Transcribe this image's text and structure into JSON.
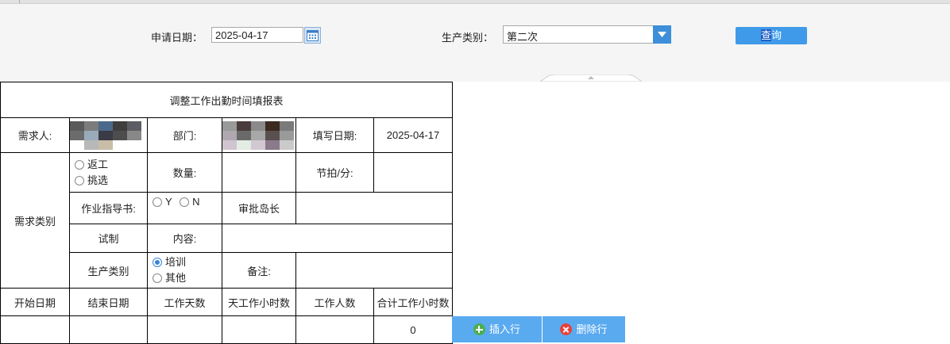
{
  "filters": {
    "apply_date_label": "申请日期：",
    "apply_date_value": "2025-04-17",
    "production_type_label": "生产类别：",
    "production_type_value": "第二次",
    "query_label_highlight": "查",
    "query_label_rest": "询"
  },
  "form": {
    "title": "调整工作出勤时间填报表",
    "requester_label": "需求人:",
    "department_label": "部门:",
    "fill_date_label": "填写日期:",
    "fill_date_value": "2025-04-17",
    "demand_type_label": "需求类别",
    "rework_option": "返工",
    "pick_option": "挑选",
    "quantity_label": "数量:",
    "takt_label": "节拍/分:",
    "work_instruction_label": "作业指导书:",
    "yes_option": "Y",
    "no_option": "N",
    "approver_label": "审批岛长",
    "trial_label": "试制",
    "content_label": "内容:",
    "production_type_label": "生产类别",
    "training_option": "培训",
    "other_option": "其他",
    "remarks_label": "备注:",
    "columns": [
      "开始日期",
      "结束日期",
      "工作天数",
      "天工作小时数",
      "工作人数",
      "合计工作小时数"
    ],
    "row": [
      "",
      "",
      "",
      "",
      "",
      "0"
    ]
  },
  "actions": {
    "insert_row": "插入行",
    "delete_row": "删除行"
  },
  "colors": {
    "accent": "#3f9be9",
    "action_button": "#5aaaf0",
    "toolbar_bg": "#f5f5f5"
  }
}
